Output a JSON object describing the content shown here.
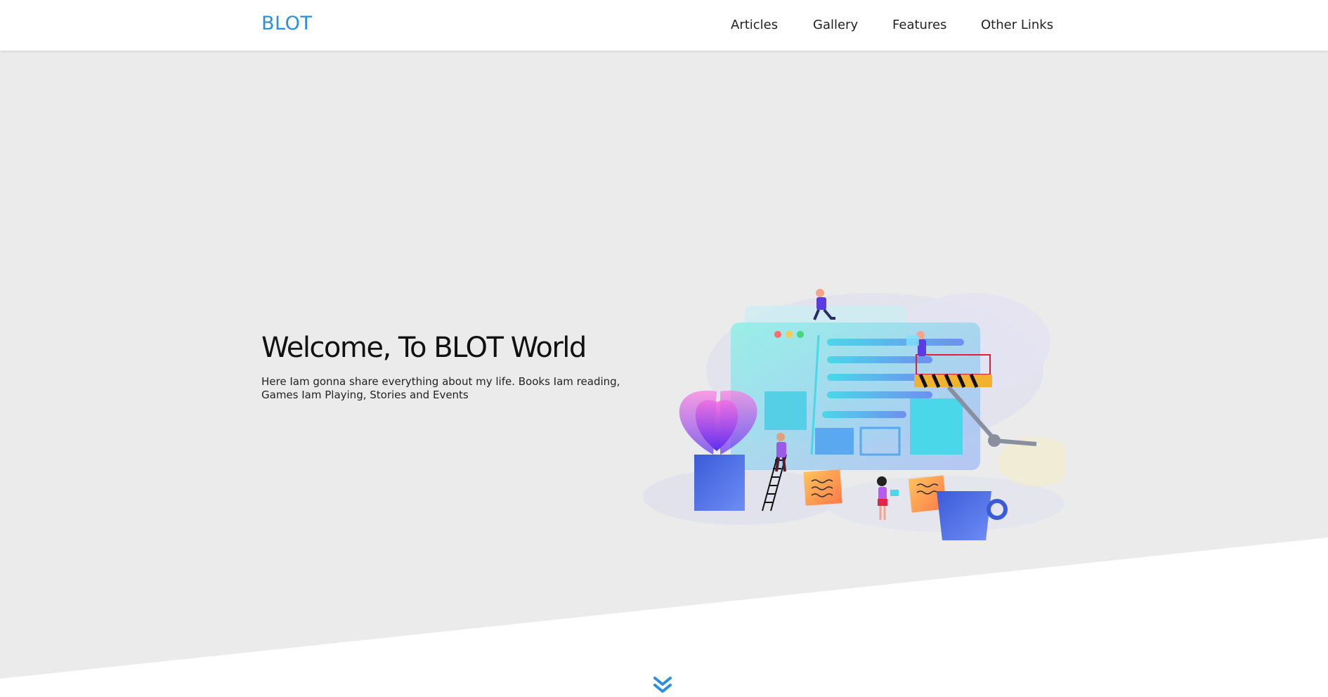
{
  "nav": {
    "brand": "BLOT",
    "links": [
      "Articles",
      "Gallery",
      "Features",
      "Other Links"
    ]
  },
  "hero": {
    "title": "Welcome, To BLOT World",
    "text": "Here Iam gonna share everything about my life. Books Iam reading, Games Iam Playing, Stories and Events"
  },
  "icons": {
    "scroll": "double-chevron-down-icon"
  },
  "colors": {
    "accent": "#2b8fe0",
    "hero_bg": "#ebebeb",
    "page_bg": "#ffffff"
  }
}
